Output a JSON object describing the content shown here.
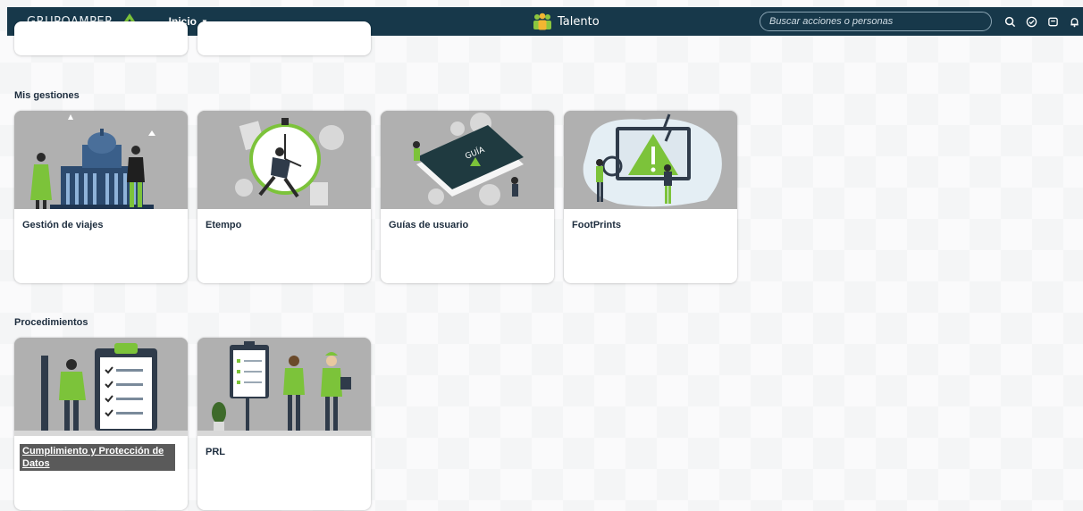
{
  "header": {
    "logo_text": "GRUPOAMPER",
    "nav_label": "Inicio",
    "brand": "Talento",
    "search_placeholder": "Buscar acciones o personas",
    "icons": [
      "search-icon",
      "check-circle-icon",
      "tickets-icon",
      "bell-icon"
    ]
  },
  "sections": {
    "mis_gestiones": {
      "title": "Mis gestiones",
      "cards": [
        {
          "label": "Gestión de viajes"
        },
        {
          "label": "Etempo"
        },
        {
          "label": "Guías de usuario"
        },
        {
          "label": "FootPrints"
        }
      ]
    },
    "procedimientos": {
      "title": "Procedimientos",
      "cards": [
        {
          "label": "Cumplimiento y Protección de Datos"
        },
        {
          "label": "PRL"
        }
      ]
    }
  },
  "colors": {
    "header_bg": "#17384a",
    "accent_green": "#7cc33a",
    "image_bg": "#b0b0b0"
  }
}
